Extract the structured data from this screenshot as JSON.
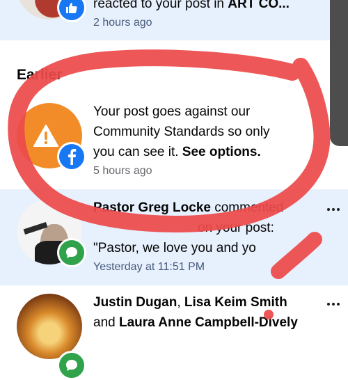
{
  "section_heading": "Earlier",
  "notifications": [
    {
      "text_prefix": "reacted to your post in ",
      "group_name": "ART CO...",
      "time": "2 hours ago",
      "badge_icon": "like-icon"
    },
    {
      "line1": "Your post goes against our",
      "line2": "Community Standards so only",
      "line3": "you can see it. ",
      "action_link": "See options.",
      "time": "5 hours ago",
      "avatar_icon": "warning-icon",
      "badge_icon": "facebook-icon"
    },
    {
      "actor": "Pastor Greg Locke",
      "verb": " commented",
      "line2": "on your post:",
      "comment_preview": "\"Pastor, we love you and yo",
      "time": "Yesterday at 11:51 PM",
      "badge_icon": "comment-icon"
    },
    {
      "actor1": "Justin Dugan",
      "separator": ", ",
      "actor2": "Lisa Keim Smith",
      "conjunction": "and ",
      "actor3": "Laura Anne Campbell-Dively",
      "badge_icon": "comment-icon"
    }
  ],
  "colors": {
    "unread_background": "#e7f0fd",
    "facebook_blue": "#1877f2",
    "warning_orange": "#f28c28",
    "comment_green": "#31a24c",
    "annotation_red": "#ec4a4a"
  }
}
